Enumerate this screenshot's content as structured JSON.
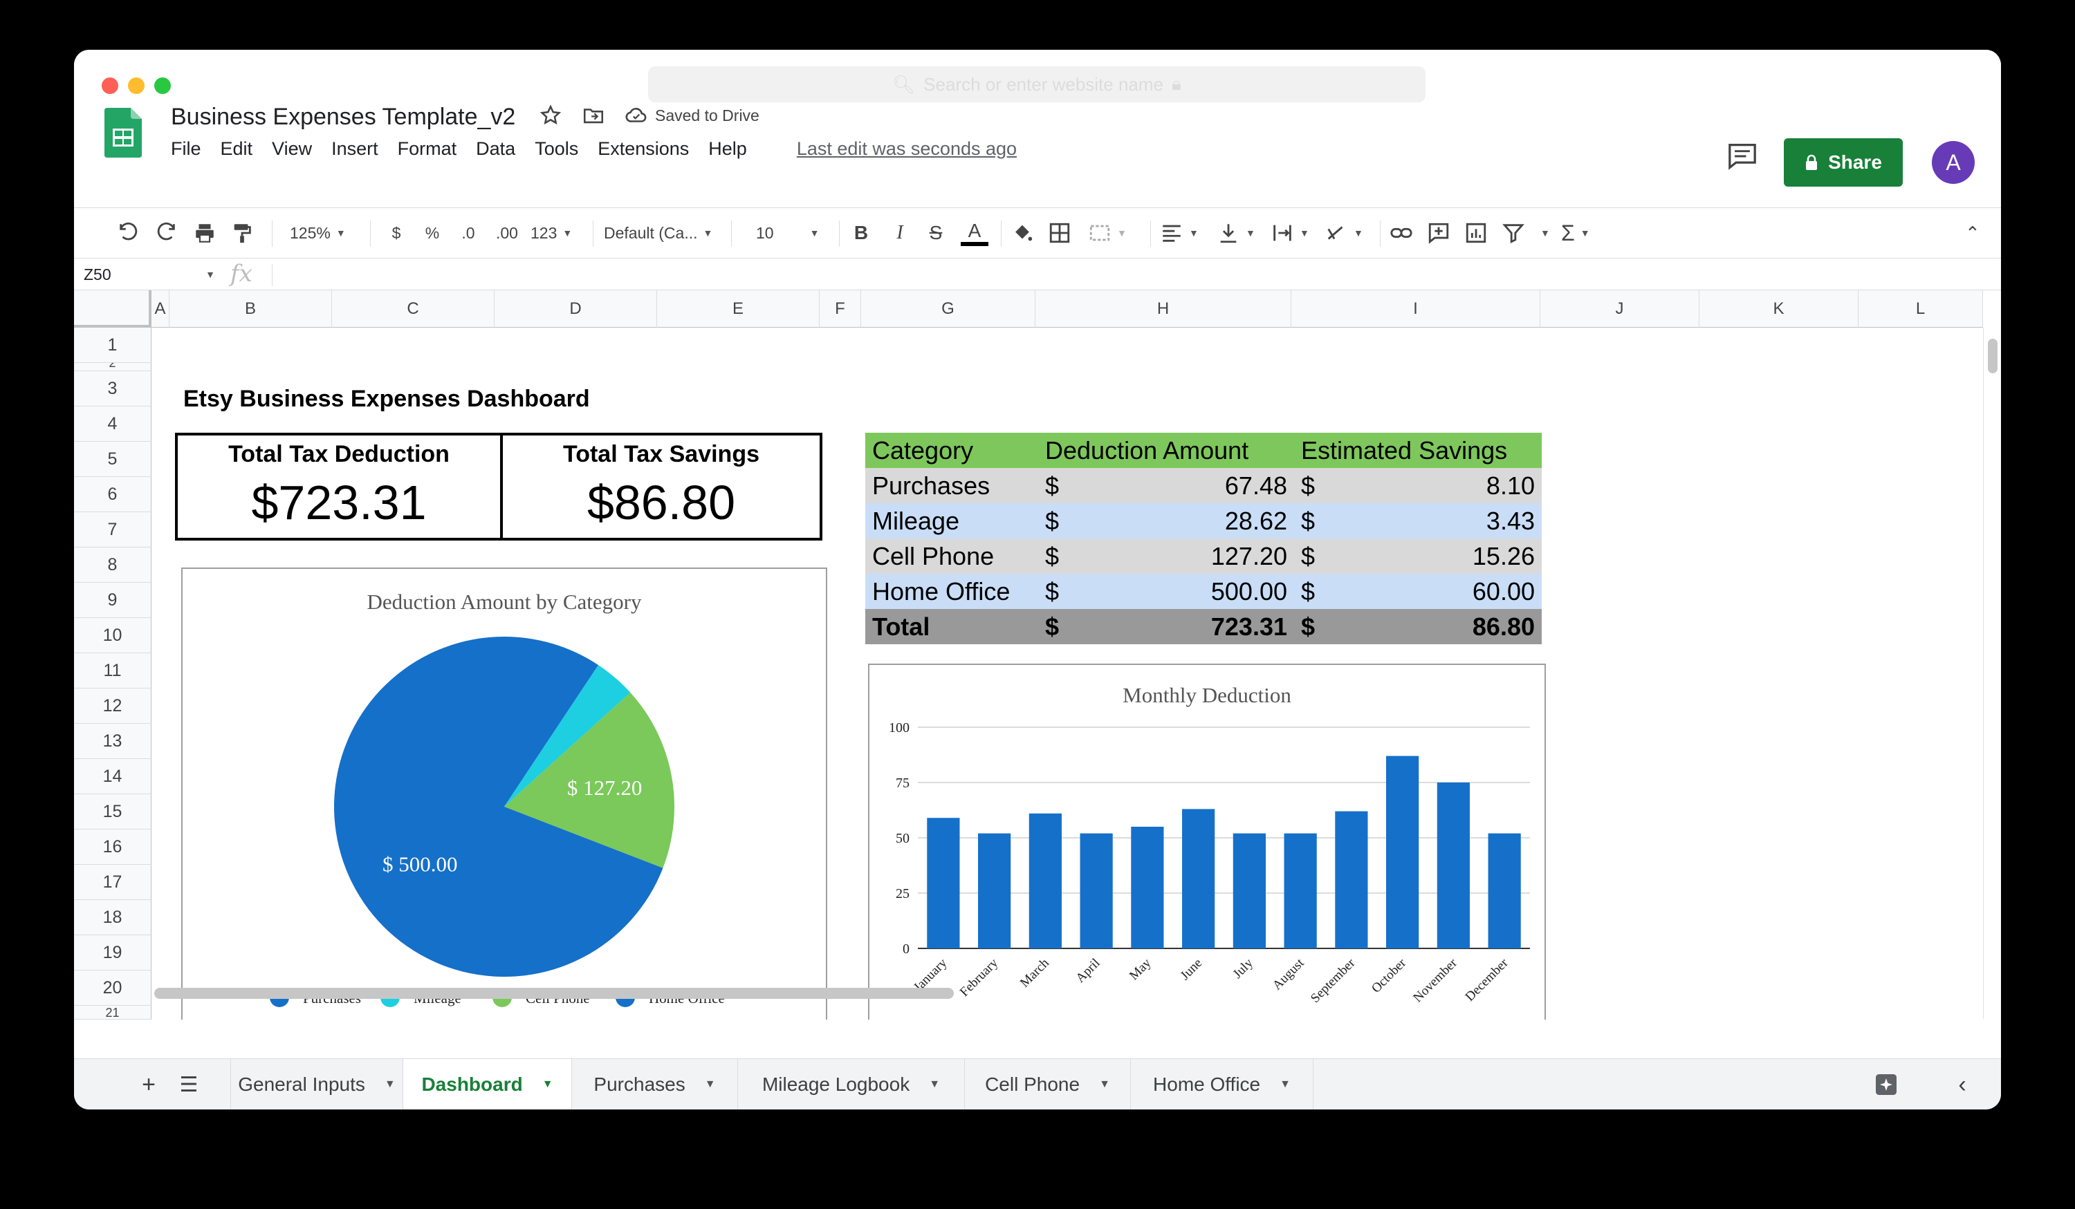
{
  "browser": {
    "url_placeholder": "Search or enter website name"
  },
  "doc": {
    "title": "Business Expenses Template_v2",
    "saved_status": "Saved to Drive",
    "last_edit": "Last edit was seconds ago"
  },
  "menu": [
    "File",
    "Edit",
    "View",
    "Insert",
    "Format",
    "Data",
    "Tools",
    "Extensions",
    "Help"
  ],
  "share_label": "Share",
  "avatar_letter": "A",
  "toolbar": {
    "zoom": "125%",
    "currency": "$",
    "percent": "%",
    "dec_decrease": ".0",
    "dec_increase": ".00",
    "more_formats": "123",
    "font": "Default (Ca...",
    "font_size": "10"
  },
  "name_box": "Z50",
  "fx": "fx",
  "columns": [
    "A",
    "B",
    "C",
    "D",
    "E",
    "F",
    "G",
    "H",
    "I",
    "J",
    "K",
    "L"
  ],
  "rows": [
    "1",
    "2",
    "3",
    "4",
    "5",
    "6",
    "7",
    "8",
    "9",
    "10",
    "11",
    "12",
    "13",
    "14",
    "15",
    "16",
    "17",
    "18",
    "19",
    "20",
    "21"
  ],
  "dashboard": {
    "title": "Etsy Business Expenses Dashboard",
    "kpi": [
      {
        "label": "Total Tax Deduction",
        "value": "$723.31"
      },
      {
        "label": "Total Tax Savings",
        "value": "$86.80"
      }
    ],
    "table": {
      "headers": [
        "Category",
        "Deduction Amount",
        "Estimated Savings"
      ],
      "rows": [
        [
          "Purchases",
          "$",
          "67.48",
          "$",
          "8.10"
        ],
        [
          "Mileage",
          "$",
          "28.62",
          "$",
          "3.43"
        ],
        [
          "Cell Phone",
          "$",
          "127.20",
          "$",
          "15.26"
        ],
        [
          "Home Office",
          "$",
          "500.00",
          "$",
          "60.00"
        ]
      ],
      "total": [
        "Total",
        "$",
        "723.31",
        "$",
        "86.80"
      ]
    }
  },
  "chart_data": [
    {
      "type": "pie",
      "title": "Deduction Amount by Category",
      "categories": [
        "Purchases",
        "Mileage",
        "Cell Phone",
        "Home Office"
      ],
      "values": [
        67.48,
        28.62,
        127.2,
        500.0
      ],
      "colors": [
        "#1570c9",
        "#1dcfe1",
        "#7ac95a",
        "#1570c9"
      ],
      "data_labels": [
        "",
        "",
        "$ 127.20",
        "$ 500.00"
      ],
      "legend": "bottom"
    },
    {
      "type": "bar",
      "title": "Monthly Deduction",
      "categories": [
        "January",
        "February",
        "March",
        "April",
        "May",
        "June",
        "July",
        "August",
        "September",
        "October",
        "November",
        "December"
      ],
      "values": [
        59,
        52,
        61,
        52,
        55,
        63,
        52,
        52,
        62,
        87,
        75,
        52
      ],
      "ylim": [
        0,
        100
      ],
      "yticks": [
        "0",
        "25",
        "50",
        "75",
        "100"
      ],
      "color": "#1570c9",
      "grid": true
    }
  ],
  "sheet_tabs": [
    "General Inputs",
    "Dashboard",
    "Purchases",
    "Mileage Logbook",
    "Cell Phone",
    "Home Office"
  ],
  "active_tab": "Dashboard"
}
